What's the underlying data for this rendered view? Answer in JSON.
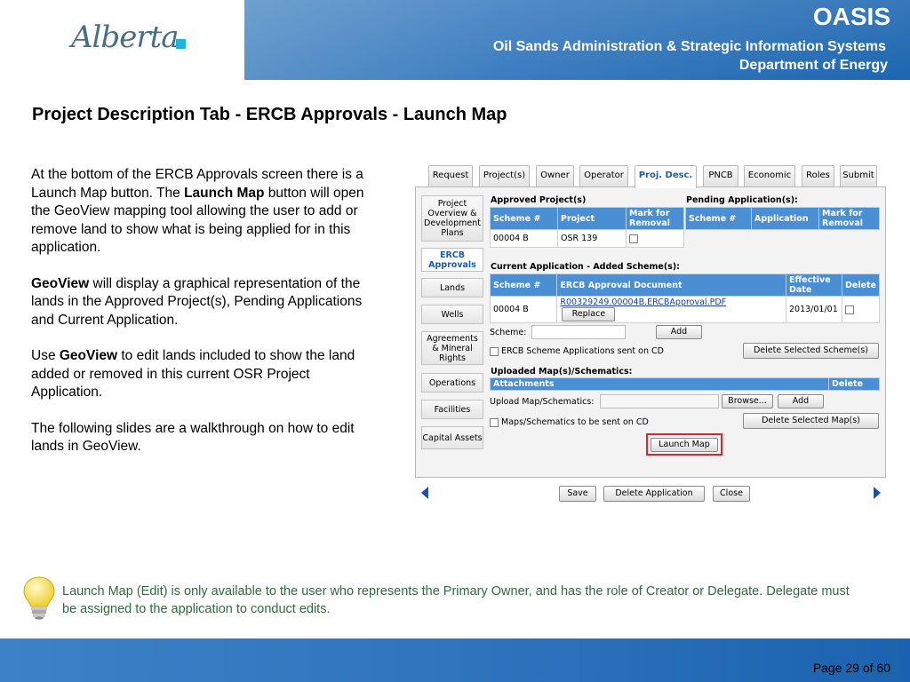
{
  "header": {
    "logo_text": "Alberta",
    "title": "OASIS",
    "subtitle1": "Oil Sands Administration & Strategic Information Systems",
    "subtitle2": "Department of Energy"
  },
  "slide_title": "Project Description Tab - ERCB Approvals - Launch Map",
  "body": {
    "p1_a": "At the bottom of the ERCB Approvals screen there is a Launch Map button. The ",
    "p1_b": "Launch Map",
    "p1_c": " button will open the GeoView mapping tool allowing the user to add or remove land to show what is being applied for in this application.",
    "p2_a": "GeoView",
    "p2_b": " will display a graphical representation of the lands in the  Approved Project(s), Pending Applications and Current Application.",
    "p3_a": "Use ",
    "p3_b": "GeoView",
    "p3_c": " to edit lands included to show the land added or removed in this current OSR Project Application.",
    "p4": "The following slides are a walkthrough on how to edit lands in GeoView."
  },
  "app": {
    "tabs": [
      "Request",
      "Project(s)",
      "Owner",
      "Operator",
      "Proj. Desc.",
      "PNCB",
      "Economic",
      "Roles",
      "Submit"
    ],
    "active_tab": "Proj. Desc.",
    "side_nav": [
      "Project Overview & Development Plans",
      "ERCB Approvals",
      "Lands",
      "Wells",
      "Agreements & Mineral Rights",
      "Operations",
      "Facilities",
      "Capital Assets"
    ],
    "active_side": "ERCB Approvals",
    "approved": {
      "title": "Approved Project(s)",
      "headers": [
        "Scheme #",
        "Project",
        "Mark for Removal"
      ],
      "row": [
        "00004 B",
        "OSR 139"
      ]
    },
    "pending": {
      "title": "Pending Application(s):",
      "headers": [
        "Scheme #",
        "Application",
        "Mark for Removal"
      ]
    },
    "current": {
      "title": "Current Application - Added Scheme(s):",
      "headers": [
        "Scheme #",
        "ERCB Approval Document",
        "Effective Date",
        "Delete"
      ],
      "row": {
        "scheme": "00004 B",
        "doc": "R00329249.00004B.ERCBApproval.PDF",
        "replace": "Replace",
        "date": "2013/01/01"
      }
    },
    "scheme_label": "Scheme:",
    "add_label": "Add",
    "ercb_cd_label": "ERCB Scheme Applications sent on CD",
    "delete_scheme_label": "Delete Selected Scheme(s)",
    "maps": {
      "title": "Uploaded Map(s)/Schematics:",
      "headers": [
        "Attachments",
        "Delete"
      ]
    },
    "upload_label": "Upload Map/Schematics:",
    "browse_label": "Browse...",
    "maps_cd_label": "Maps/Schematics to be sent on CD",
    "delete_maps_label": "Delete Selected Map(s)",
    "launch_map_label": "Launch Map"
  },
  "bottom_buttons": [
    "Save",
    "Delete Application",
    "Close"
  ],
  "note": "Launch Map (Edit)  is only available to the user who represents the Primary Owner, and has the role of Creator or Delegate.  Delegate must be assigned to the application to conduct edits.",
  "page_number": "Page 29 of 60",
  "colors": {
    "banner": "#2f74bd",
    "header_cell": "#4a8fd4",
    "note_text": "#2e6b3d",
    "highlight": "#e0242d"
  }
}
